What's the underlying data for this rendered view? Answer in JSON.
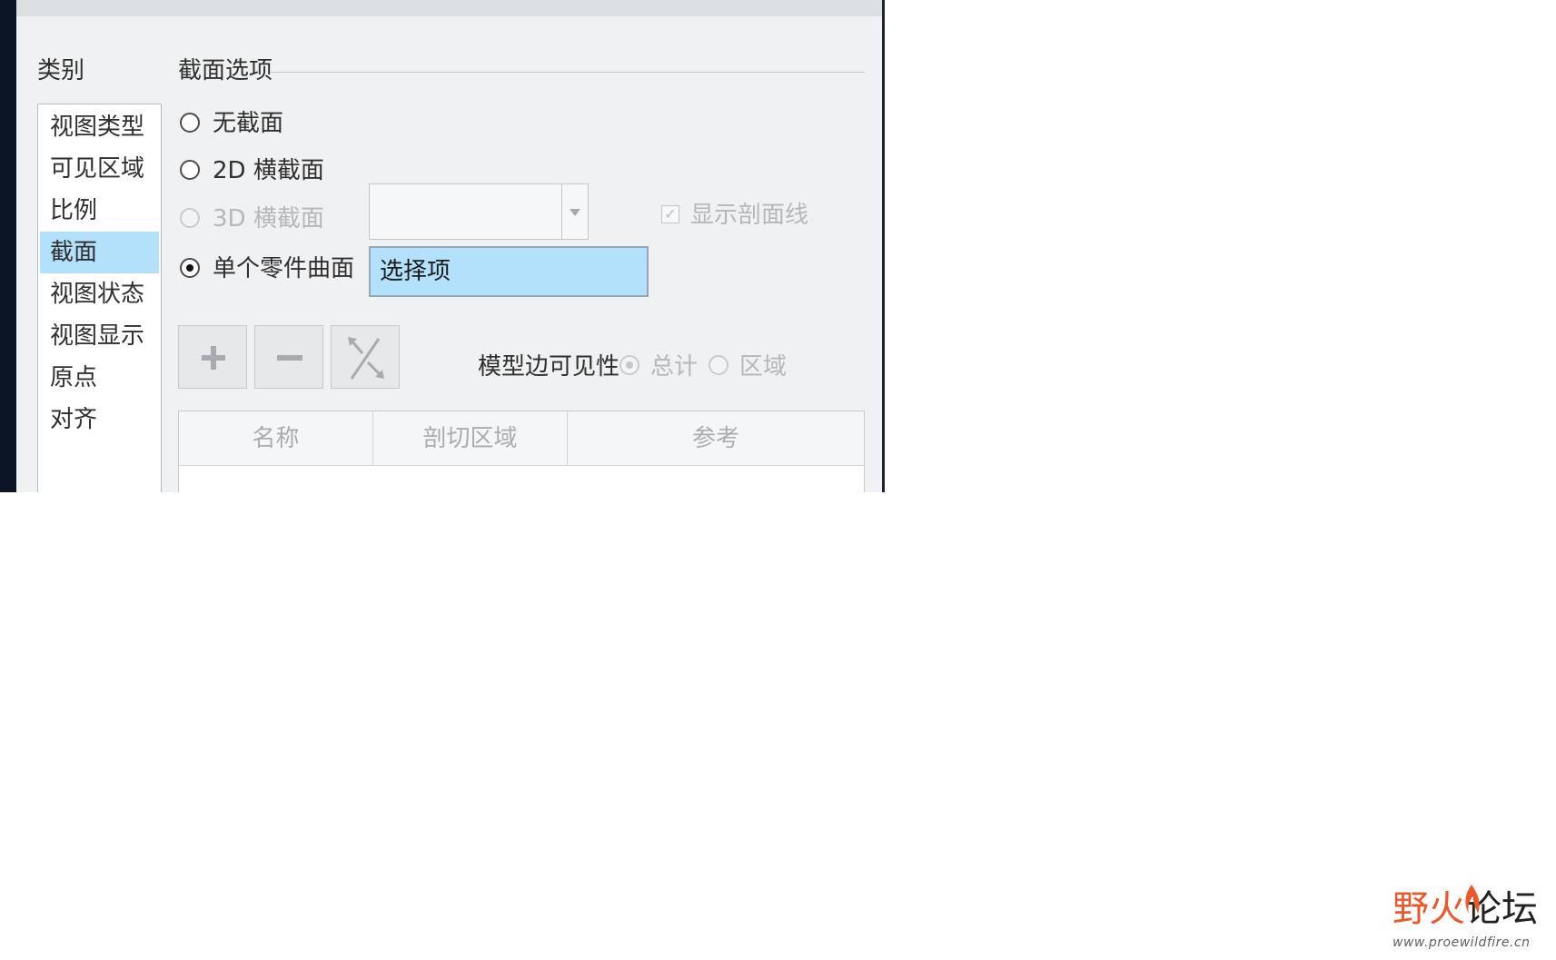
{
  "category": {
    "label": "类别",
    "items": [
      {
        "label": "视图类型",
        "selected": false
      },
      {
        "label": "可见区域",
        "selected": false
      },
      {
        "label": "比例",
        "selected": false
      },
      {
        "label": "截面",
        "selected": true
      },
      {
        "label": "视图状态",
        "selected": false
      },
      {
        "label": "视图显示",
        "selected": false
      },
      {
        "label": "原点",
        "selected": false
      },
      {
        "label": "对齐",
        "selected": false
      }
    ]
  },
  "section_options": {
    "title": "截面选项",
    "radios": [
      {
        "label": "无截面",
        "checked": false,
        "enabled": true
      },
      {
        "label": "2D 横截面",
        "checked": false,
        "enabled": true
      },
      {
        "label": "3D 横截面",
        "checked": false,
        "enabled": false
      },
      {
        "label": "单个零件曲面",
        "checked": true,
        "enabled": true
      }
    ],
    "combo_value": "",
    "select_box_label": "选择项",
    "show_hatch_label": "显示剖面线",
    "show_hatch_checked": true,
    "show_hatch_enabled": false
  },
  "toolbar": {
    "add_icon": "plus-icon",
    "remove_icon": "minus-icon",
    "flip_icon": "flip-direction-icon"
  },
  "model_edge": {
    "label": "模型边可见性",
    "options": [
      {
        "label": "总计",
        "checked": true,
        "enabled": false
      },
      {
        "label": "区域",
        "checked": false,
        "enabled": false
      }
    ]
  },
  "table": {
    "columns": [
      "名称",
      "剖切区域",
      "参考"
    ],
    "rows": []
  },
  "watermark": {
    "title_part1": "野火",
    "title_part2": "论坛",
    "url": "www.proewildfire.cn"
  },
  "colors": {
    "selection": "#b3e0fa",
    "dialog_bg": "#f0f1f2",
    "brand_orange": "#e9592a"
  }
}
